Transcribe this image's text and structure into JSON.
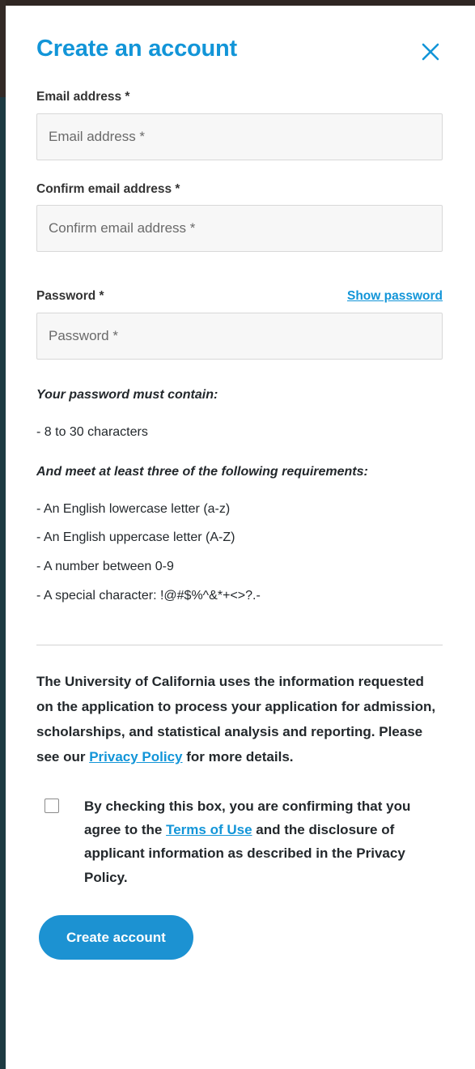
{
  "modal": {
    "title": "Create an account",
    "close_icon": "close-icon"
  },
  "fields": {
    "email": {
      "label": "Email address *",
      "placeholder": "Email address *",
      "value": ""
    },
    "confirm_email": {
      "label": "Confirm email address *",
      "placeholder": "Confirm email address *",
      "value": ""
    },
    "password": {
      "label": "Password *",
      "placeholder": "Password *",
      "value": "",
      "show_password_label": "Show password"
    }
  },
  "password_rules": {
    "heading_1": "Your password must contain:",
    "rules_1": [
      "- 8 to 30 characters"
    ],
    "heading_2": "And meet at least three of the following requirements:",
    "rules_2": [
      "- An English lowercase letter (a-z)",
      "- An English uppercase letter (A-Z)",
      "- A number between 0-9",
      "- A special character: !@#$%^&*+<>?.-"
    ]
  },
  "privacy": {
    "text_part_1": "The University of California uses the information requested on the application to process your application for admission, scholarships, and statistical analysis and reporting. Please see our ",
    "link_label": "Privacy Policy",
    "text_part_2": " for more details."
  },
  "consent": {
    "text_part_1": "By checking this box, you are confirming that you agree to the ",
    "link_label": "Terms of Use",
    "text_part_2": " and the disclosure of applicant information as described in the Privacy Policy.",
    "checked": false
  },
  "submit": {
    "label": "Create account"
  },
  "colors": {
    "accent": "#1295d8",
    "button": "#1c92d2",
    "text": "#23282c",
    "label": "#333333",
    "input_bg": "#f7f7f7",
    "input_border": "#d8d8d8",
    "divider": "#d3d3d3",
    "edge_top": "#2f2622",
    "edge_left": "#1d3a42"
  }
}
